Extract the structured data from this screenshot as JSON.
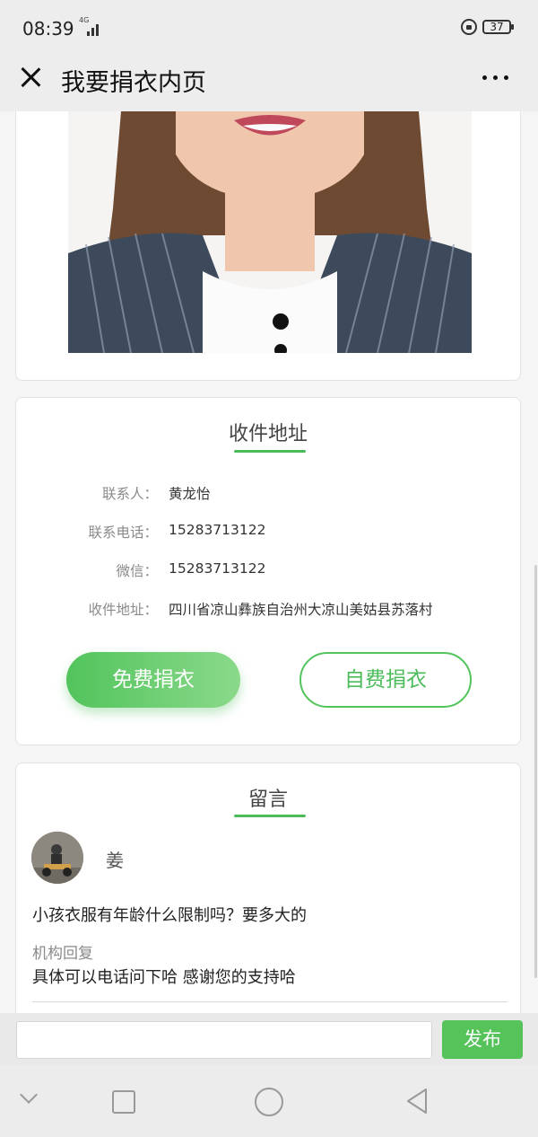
{
  "status_bar": {
    "time": "08:39",
    "network": "4G",
    "battery": "37"
  },
  "header": {
    "title": "我要捐衣内页"
  },
  "address": {
    "title": "收件地址",
    "rows": [
      {
        "label": "联系人：",
        "value": "黄龙怡"
      },
      {
        "label": "联系电话：",
        "value": "15283713122"
      },
      {
        "label": "微信：",
        "value": "15283713122"
      },
      {
        "label": "收件地址：",
        "value": "四川省凉山彝族自治州大凉山美姑县苏落村"
      }
    ],
    "free_button": "免费捐衣",
    "self_button": "自费捐衣"
  },
  "messages": {
    "title": "留言",
    "items": [
      {
        "user": "姜",
        "text": "小孩衣服有年龄什么限制吗？要多大的",
        "reply_label": "机构回复",
        "reply": "具体可以电话问下哈 感谢您的支持哈"
      }
    ]
  },
  "input_bar": {
    "placeholder": "",
    "publish": "发布"
  },
  "colors": {
    "accent": "#4cbc5b",
    "background": "#f5f5f5"
  }
}
